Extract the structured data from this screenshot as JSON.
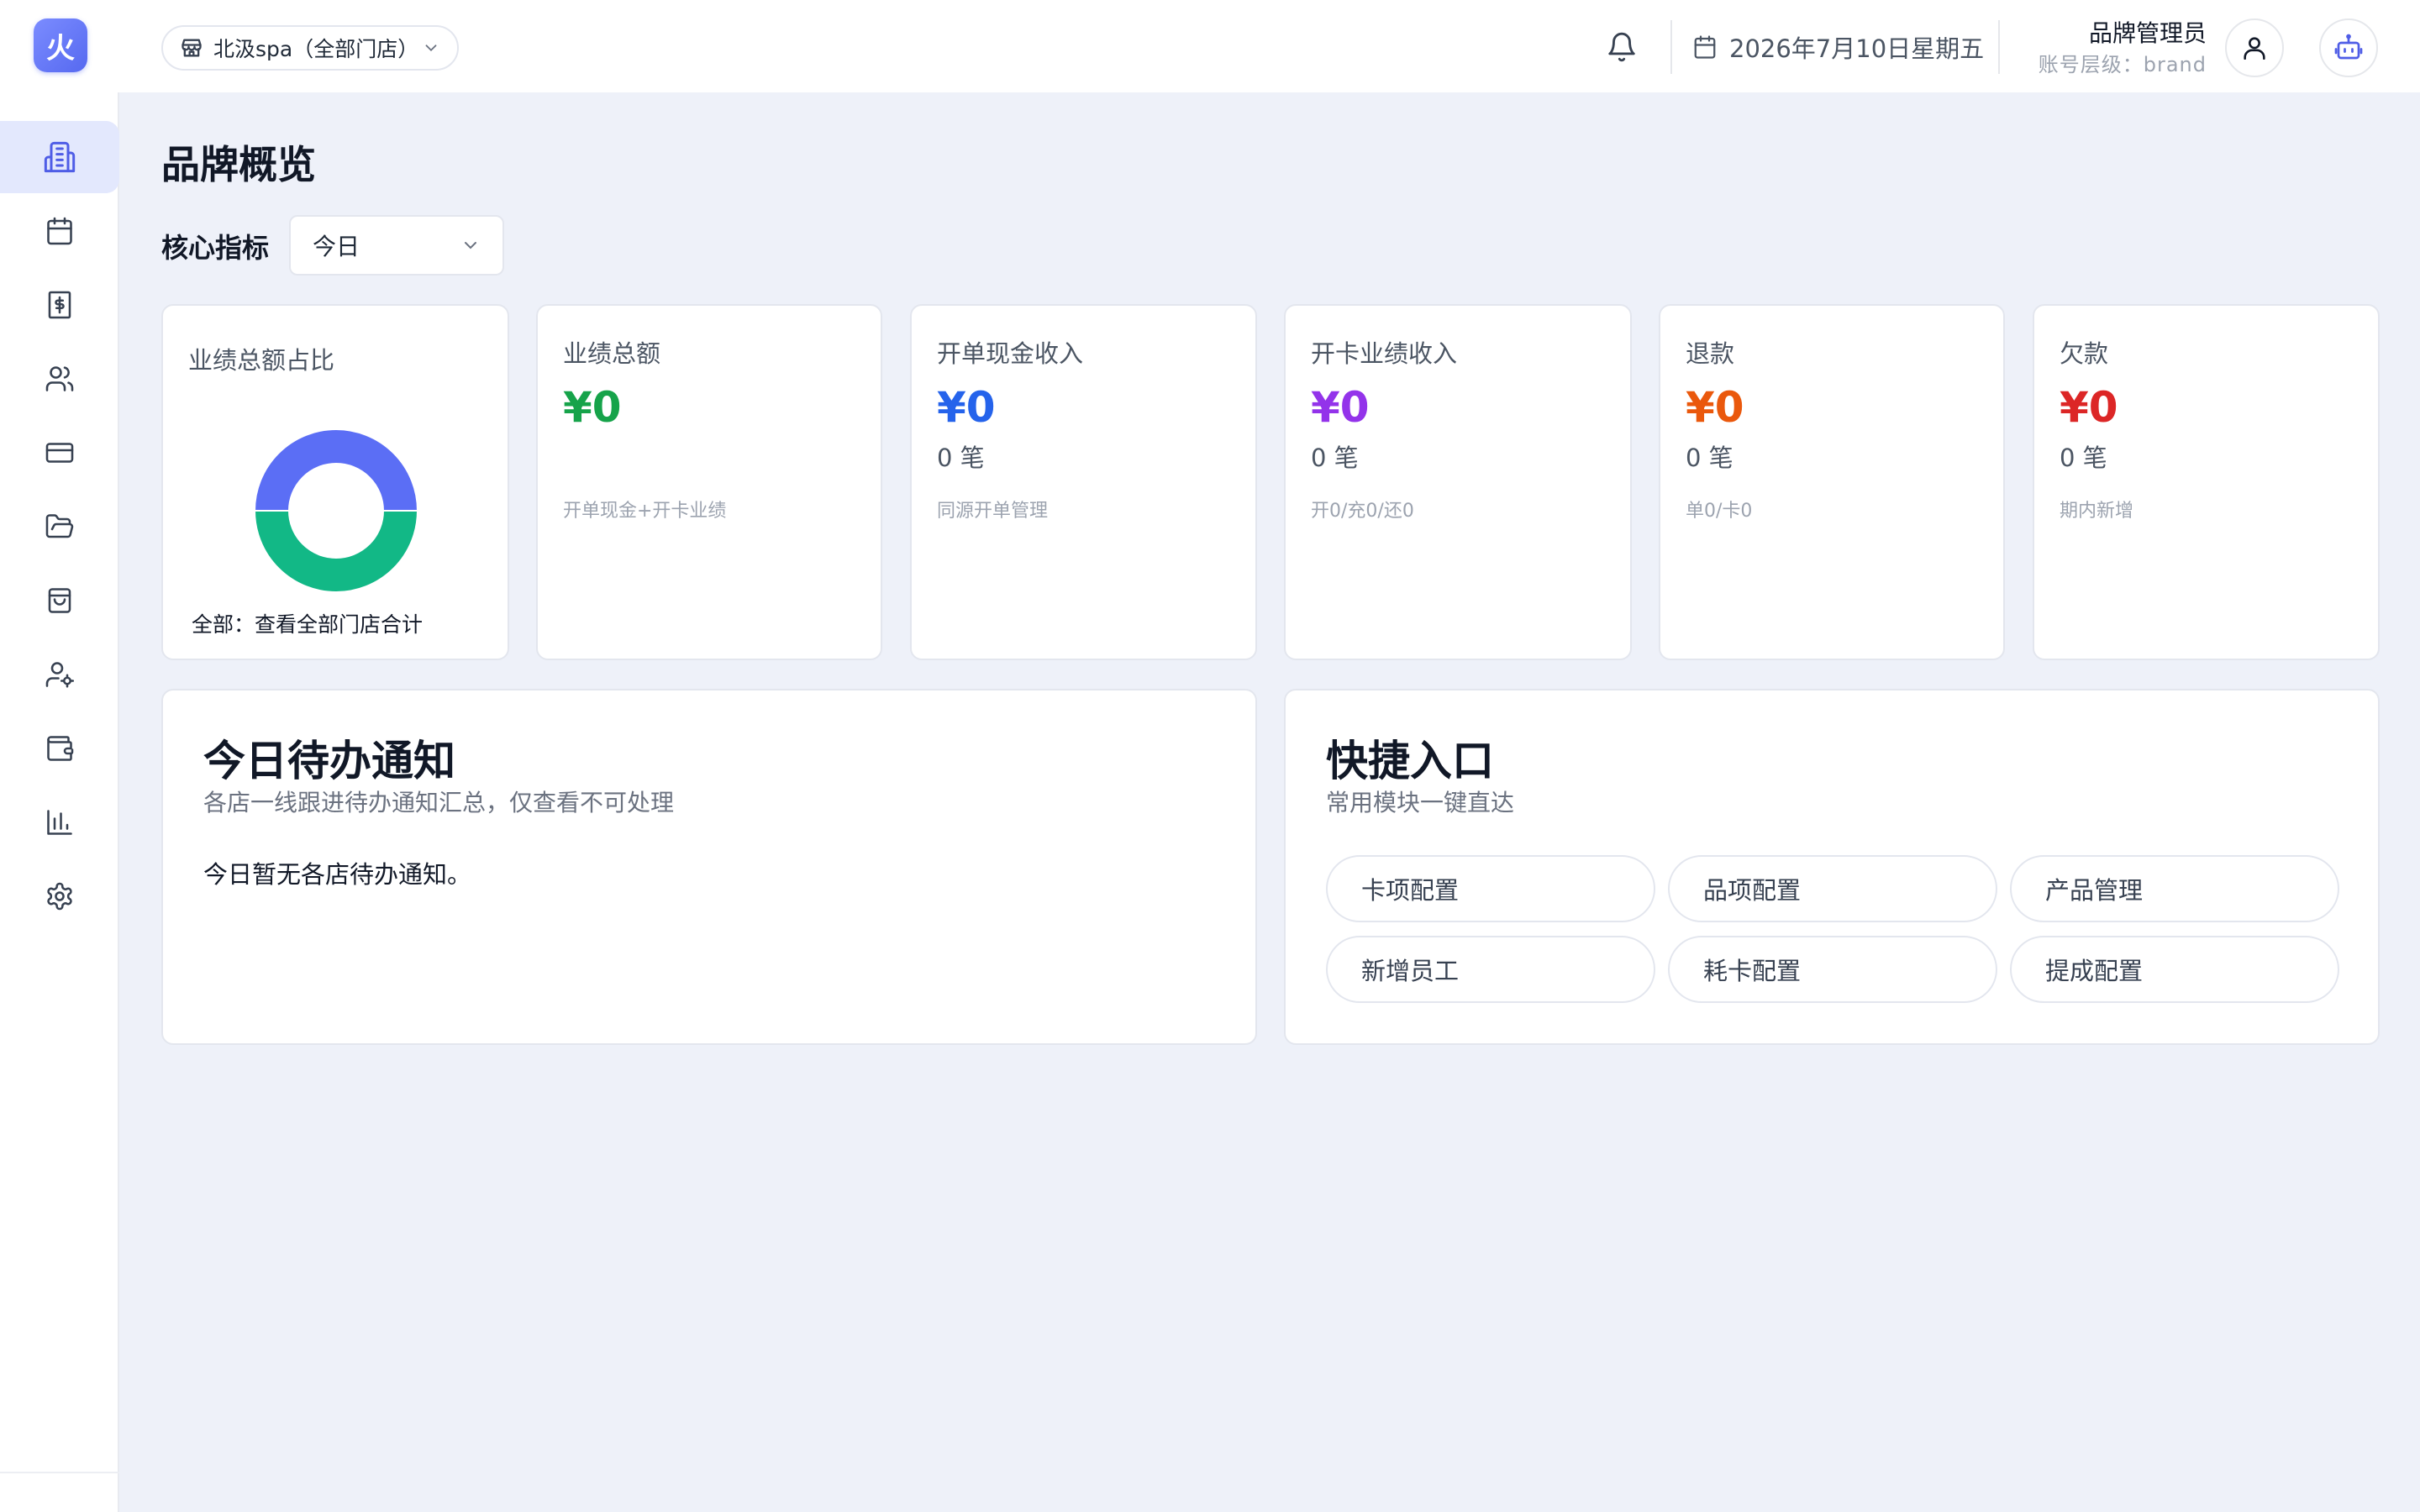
{
  "header": {
    "logo_glyph": "火",
    "store_select": "北汲spa（全部门店）",
    "date": "2026年7月10日星期五",
    "user_name": "品牌管理员",
    "user_level": "账号层级：brand"
  },
  "sidebar": {
    "items": [
      {
        "icon": "building-icon",
        "active": true
      },
      {
        "icon": "calendar-icon",
        "active": false
      },
      {
        "icon": "dollar-receipt-icon",
        "active": false
      },
      {
        "icon": "users-icon",
        "active": false
      },
      {
        "icon": "credit-card-icon",
        "active": false
      },
      {
        "icon": "folder-open-icon",
        "active": false
      },
      {
        "icon": "shopping-bag-icon",
        "active": false
      },
      {
        "icon": "user-cog-icon",
        "active": false
      },
      {
        "icon": "wallet-icon",
        "active": false
      },
      {
        "icon": "bar-chart-icon",
        "active": false
      },
      {
        "icon": "settings-icon",
        "active": false
      }
    ]
  },
  "main": {
    "title": "品牌概览",
    "metrics_label": "核心指标",
    "period_select": "今日",
    "share_card": {
      "title": "业绩总额占比",
      "caption": "全部：查看全部门店合计",
      "segments": [
        {
          "fraction": 0.5,
          "color": "#5b6ef5"
        },
        {
          "fraction": 0.5,
          "color": "#12b886"
        }
      ]
    },
    "cards": [
      {
        "title": "业绩总额",
        "value": "¥0",
        "count": "",
        "note": "开单现金+开卡业绩",
        "color": "#16a34a"
      },
      {
        "title": "开单现金收入",
        "value": "¥0",
        "count": "0 笔",
        "note": "同源开单管理",
        "color": "#2563eb"
      },
      {
        "title": "开卡业绩收入",
        "value": "¥0",
        "count": "0 笔",
        "note": "开0/充0/还0",
        "color": "#9333ea"
      },
      {
        "title": "退款",
        "value": "¥0",
        "count": "0 笔",
        "note": "单0/卡0",
        "color": "#ea580c"
      },
      {
        "title": "欠款",
        "value": "¥0",
        "count": "0 笔",
        "note": "期内新增",
        "color": "#dc2626"
      }
    ],
    "todo_panel": {
      "title": "今日待办通知",
      "subtitle": "各店一线跟进待办通知汇总，仅查看不可处理",
      "empty_text": "今日暂无各店待办通知。"
    },
    "quick_panel": {
      "title": "快捷入口",
      "subtitle": "常用模块一键直达",
      "buttons": [
        "卡项配置",
        "品项配置",
        "产品管理",
        "新增员工",
        "耗卡配置",
        "提成配置"
      ]
    }
  }
}
